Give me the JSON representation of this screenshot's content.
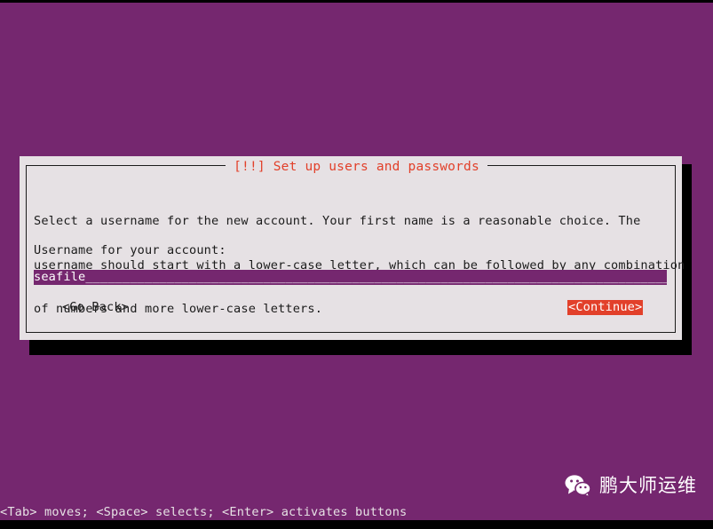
{
  "screen": {
    "background_color": "#75276f",
    "foreground_color": "#e6e1e4"
  },
  "dialog": {
    "title": "[!!] Set up users and passwords",
    "title_color": "#e2402a",
    "background_color": "#e6e1e4",
    "border_color": "#1b1b1b",
    "body_lines": [
      "Select a username for the new account. Your first name is a reasonable choice. The",
      "username should start with a lower-case letter, which can be followed by any combination",
      "of numbers and more lower-case letters."
    ],
    "field_label": "Username for your account:",
    "input": {
      "value": "seafile",
      "fill": "_______________________________________________________________________________",
      "background_color": "#75276f",
      "text_color": "#ffffff",
      "cursor_visible": true
    },
    "buttons": {
      "go_back": "<Go Back>",
      "continue": "<Continue>",
      "continue_selected": true,
      "continue_background_color": "#e2402a",
      "continue_text_color": "#ffffff"
    }
  },
  "help_bar": {
    "text": "<Tab> moves; <Space> selects; <Enter> activates buttons"
  },
  "watermark": {
    "icon": "wechat-icon",
    "text": "鹏大师运维",
    "color": "#ffffff"
  }
}
